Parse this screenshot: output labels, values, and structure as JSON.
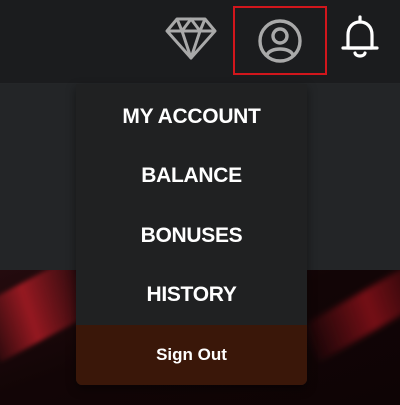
{
  "header": {
    "icons": {
      "diamond": "diamond-icon",
      "user": "user-icon",
      "bell": "bell-icon"
    },
    "highlight_color": "#d1161c"
  },
  "account_menu": {
    "items": [
      {
        "label": "MY ACCOUNT"
      },
      {
        "label": "BALANCE"
      },
      {
        "label": "BONUSES"
      },
      {
        "label": "HISTORY"
      }
    ],
    "sign_out_label": "Sign Out",
    "sign_out_color": "#3a1709"
  }
}
